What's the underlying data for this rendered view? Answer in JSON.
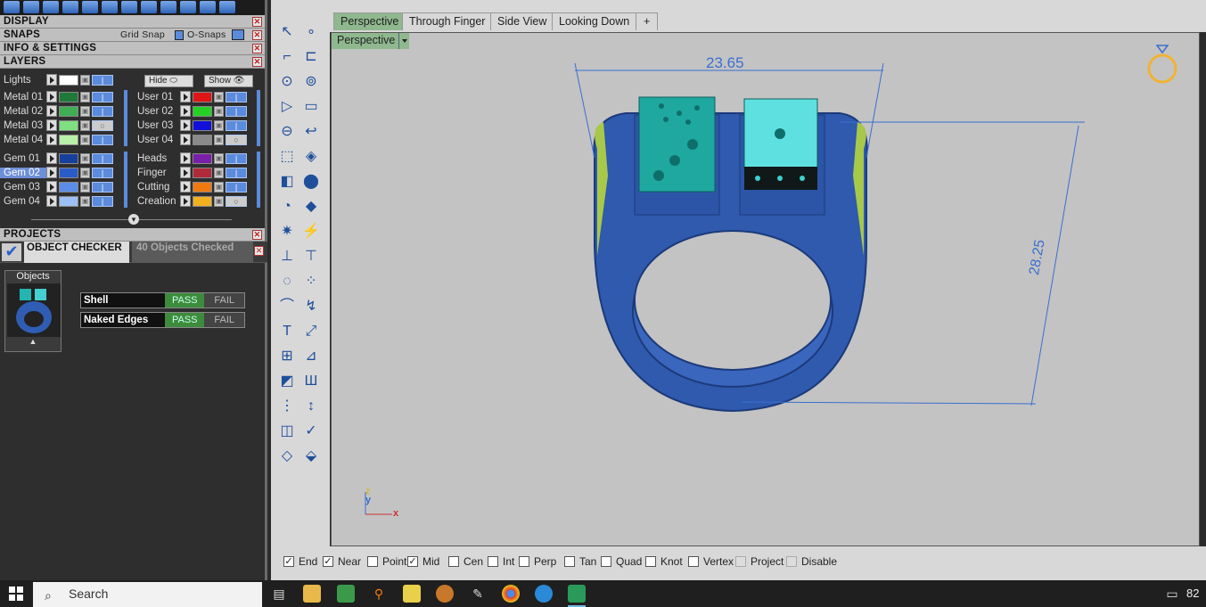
{
  "sections": {
    "display": "DISPLAY",
    "snaps": "SNAPS",
    "grid_snap": "Grid Snap",
    "o_snaps": "O-Snaps",
    "info": "INFO & SETTINGS",
    "layers": "LAYERS",
    "projects": "PROJECTS"
  },
  "layers": {
    "lights": "Lights",
    "hide": "Hide",
    "show": "Show",
    "left": [
      {
        "name": "Metal 01",
        "color": "#1f7a3a"
      },
      {
        "name": "Metal 02",
        "color": "#3fae55"
      },
      {
        "name": "Metal 03",
        "color": "#7fe07f"
      },
      {
        "name": "Metal 04",
        "color": "#b8f0a8"
      },
      {
        "name": "Gem 01",
        "color": "#173f9c"
      },
      {
        "name": "Gem 02",
        "color": "#2a5cc8"
      },
      {
        "name": "Gem 03",
        "color": "#5b8de8"
      },
      {
        "name": "Gem 04",
        "color": "#9cc0f5"
      }
    ],
    "right": [
      {
        "name": "User 01",
        "color": "#e01515"
      },
      {
        "name": "User 02",
        "color": "#25d025"
      },
      {
        "name": "User 03",
        "color": "#1010d8"
      },
      {
        "name": "User 04",
        "color": "#8a8a8a"
      },
      {
        "name": "Heads",
        "color": "#7a1fa8"
      },
      {
        "name": "Finger",
        "color": "#b02a3a"
      },
      {
        "name": "Cutting",
        "color": "#f07a10"
      },
      {
        "name": "Creation",
        "color": "#f0b020"
      }
    ]
  },
  "object_checker": {
    "title": "OBJECT CHECKER",
    "count": "40  Objects Checked",
    "objects_label": "Objects",
    "checks": [
      {
        "name": "Shell",
        "pass": "PASS",
        "fail": "FAIL"
      },
      {
        "name": "Naked Edges",
        "pass": "PASS",
        "fail": "FAIL"
      }
    ]
  },
  "tabs": [
    "Perspective",
    "Through Finger",
    "Side View",
    "Looking Down"
  ],
  "tab_add": "+",
  "viewport": {
    "label": "Perspective",
    "dim_width": "23.65",
    "dim_height": "28.25",
    "axis_x": "x",
    "axis_y": "y",
    "axis_z": "z"
  },
  "osnaps": [
    {
      "label": "End",
      "checked": true
    },
    {
      "label": "Near",
      "checked": true
    },
    {
      "label": "Point",
      "checked": false
    },
    {
      "label": "Mid",
      "checked": true
    },
    {
      "label": "Cen",
      "checked": false
    },
    {
      "label": "Int",
      "checked": false
    },
    {
      "label": "Perp",
      "checked": false
    },
    {
      "label": "Tan",
      "checked": false
    },
    {
      "label": "Quad",
      "checked": false
    },
    {
      "label": "Knot",
      "checked": false
    },
    {
      "label": "Vertex",
      "checked": false
    },
    {
      "label": "Project",
      "checked": false
    },
    {
      "label": "Disable",
      "checked": false
    }
  ],
  "taskbar": {
    "search": "Search",
    "tray_text": "82"
  }
}
